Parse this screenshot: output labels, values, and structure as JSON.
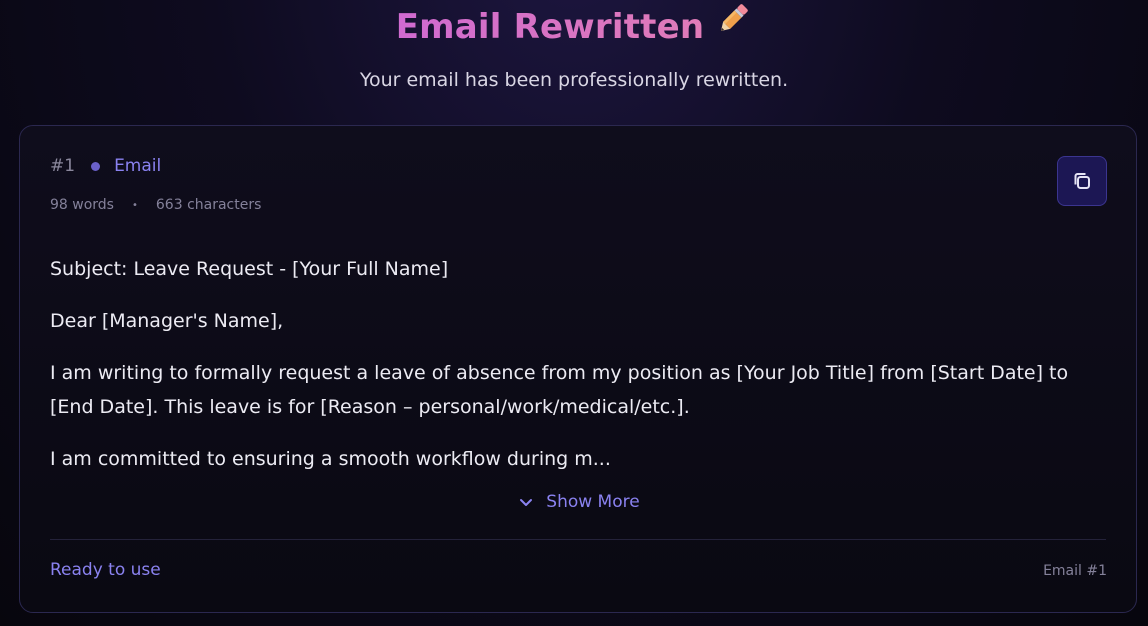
{
  "header": {
    "title": "Email Rewritten",
    "title_icon": "pencil-icon",
    "subtitle": "Your email has been professionally rewritten."
  },
  "card": {
    "number": "#1",
    "type": "Email",
    "words": "98 words",
    "separator": "•",
    "characters": "663 characters",
    "copy_icon": "copy-icon",
    "body": {
      "subject": "Subject: Leave Request - [Your Full Name]",
      "greeting": "Dear [Manager's Name],",
      "paragraph1": "I am writing to formally request a leave of absence from my position as [Your Job Title] from [Start Date] to [End Date]. This leave is for [Reason – personal/work/medical/etc.].",
      "paragraph2": "I am committed to ensuring a smooth workflow during m..."
    },
    "show_more_label": "Show More",
    "status": "Ready to use",
    "footer_label": "Email #1"
  },
  "colors": {
    "accent": "#8a82f0",
    "title_gradient_start": "#d06ad0",
    "title_gradient_end": "#e07bb8",
    "background": "#07060d"
  }
}
